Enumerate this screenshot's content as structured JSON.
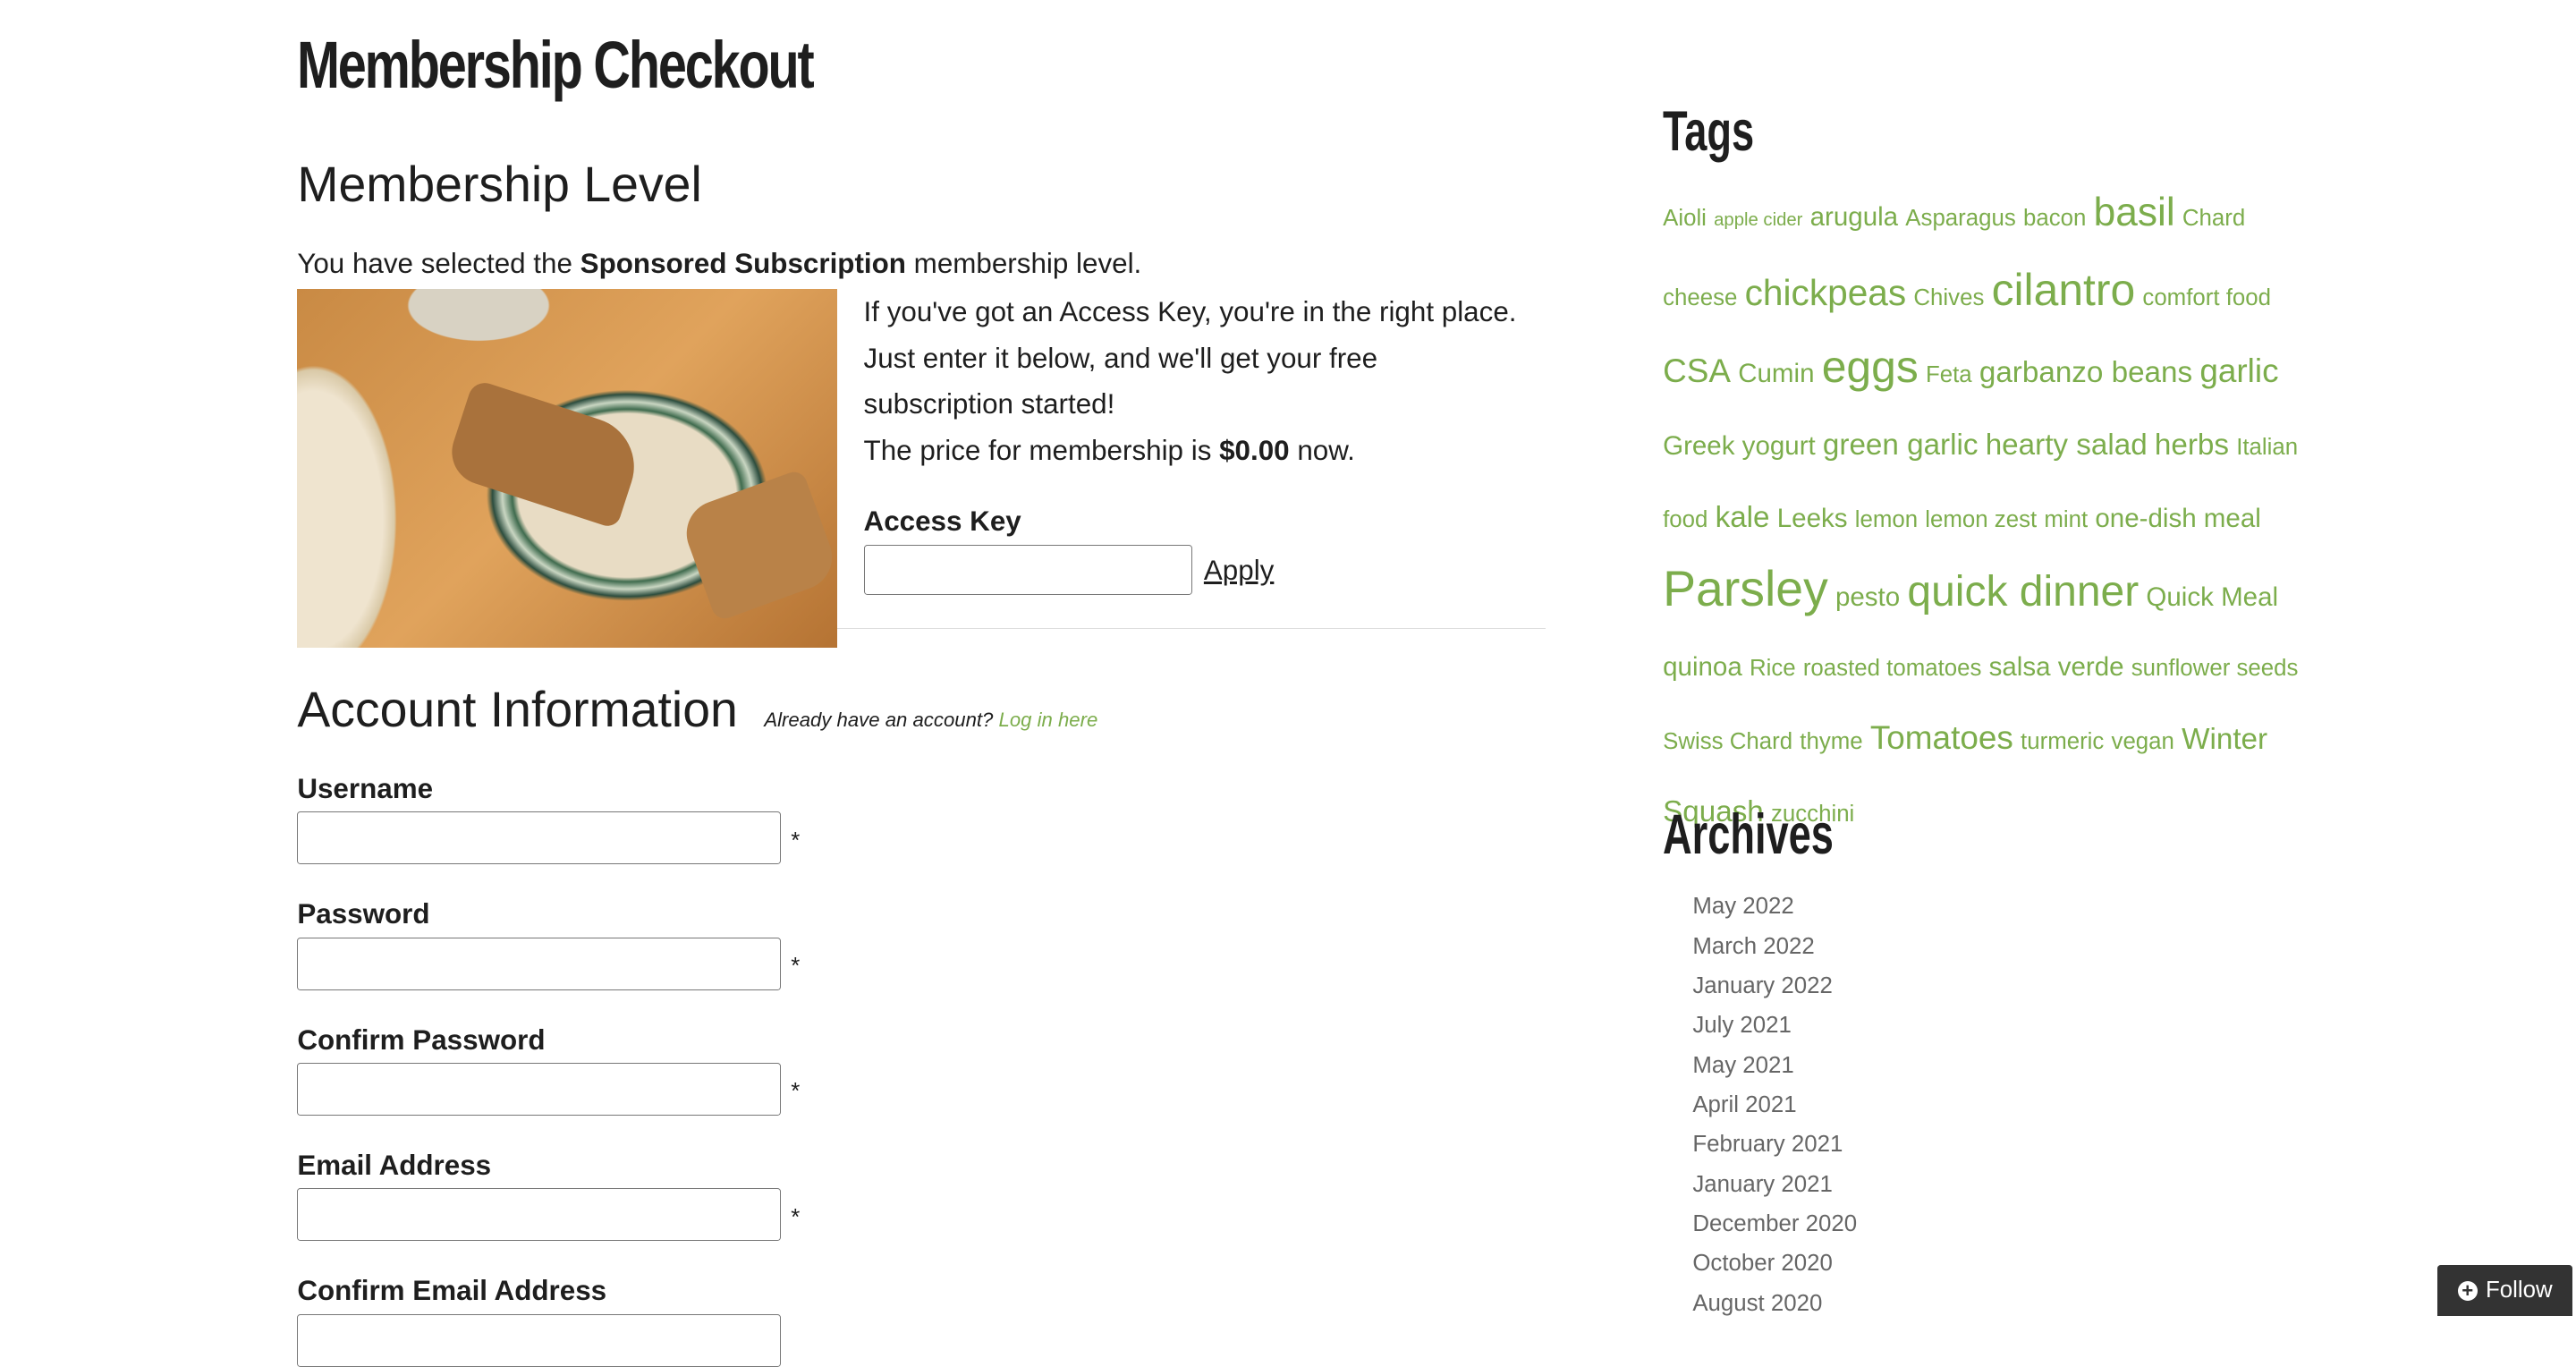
{
  "page": {
    "title": "Membership Checkout"
  },
  "level": {
    "heading": "Membership Level",
    "selected_prefix": "You have selected the ",
    "level_name": "Sponsored Subscription",
    "selected_suffix": " membership level.",
    "promo": "If you've got an Access Key, you're in the right place. Just enter it below, and we'll get your free subscription started!",
    "price_prefix": "The price for membership is ",
    "price": "$0.00",
    "price_suffix": " now.",
    "access_key_label": "Access Key",
    "access_key_value": "",
    "apply_label": "Apply"
  },
  "account": {
    "heading": "Account Information",
    "have_account": "Already have an account? ",
    "login_link": "Log in here",
    "fields": [
      {
        "label": "Username",
        "required": "*"
      },
      {
        "label": "Password",
        "required": "*"
      },
      {
        "label": "Confirm Password",
        "required": "*"
      },
      {
        "label": "Email Address",
        "required": "*"
      },
      {
        "label": "Confirm Email Address",
        "required": ""
      }
    ]
  },
  "sidebar": {
    "tags_heading": "Tags",
    "tags": [
      [
        "Aioli",
        14
      ],
      [
        "apple cider",
        11
      ],
      [
        "arugula",
        16
      ],
      [
        "Asparagus",
        14
      ],
      [
        "bacon",
        14
      ],
      [
        "basil",
        24
      ],
      [
        "Chard",
        14
      ],
      [
        "cheese",
        14
      ],
      [
        "chickpeas",
        22
      ],
      [
        "Chives",
        14
      ],
      [
        "cilantro",
        27
      ],
      [
        "comfort food",
        14
      ],
      [
        "CSA",
        20
      ],
      [
        "Cumin",
        16
      ],
      [
        "eggs",
        27
      ],
      [
        "Feta",
        14
      ],
      [
        "garbanzo beans",
        18
      ],
      [
        "garlic",
        20
      ],
      [
        "Greek yogurt",
        16
      ],
      [
        "green garlic",
        18
      ],
      [
        "hearty salad",
        18
      ],
      [
        "herbs",
        18
      ],
      [
        "Italian food",
        14
      ],
      [
        "kale",
        18
      ],
      [
        "Leeks",
        16
      ],
      [
        "lemon",
        14
      ],
      [
        "lemon zest",
        14
      ],
      [
        "mint",
        14
      ],
      [
        "one-dish meal",
        16
      ],
      [
        "Parsley",
        30
      ],
      [
        "pesto",
        16
      ],
      [
        "quick dinner",
        26
      ],
      [
        "Quick Meal",
        16
      ],
      [
        "quinoa",
        16
      ],
      [
        "Rice",
        14
      ],
      [
        "roasted tomatoes",
        14
      ],
      [
        "salsa verde",
        16
      ],
      [
        "sunflower seeds",
        14
      ],
      [
        "Swiss Chard",
        14
      ],
      [
        "thyme",
        14
      ],
      [
        "Tomatoes",
        20
      ],
      [
        "turmeric",
        14
      ],
      [
        "vegan",
        14
      ],
      [
        "Winter Squash",
        18
      ],
      [
        "zucchini",
        14
      ]
    ],
    "archives_heading": "Archives",
    "archives": [
      "May 2022",
      "March 2022",
      "January 2022",
      "July 2021",
      "May 2021",
      "April 2021",
      "February 2021",
      "January 2021",
      "December 2020",
      "October 2020",
      "August 2020"
    ]
  },
  "follow": {
    "label": "Follow",
    "icon": "plus-circle-icon"
  },
  "colors": {
    "accent": "#7cad4c",
    "text": "#1e1e1e",
    "follow_bg": "#333333"
  }
}
